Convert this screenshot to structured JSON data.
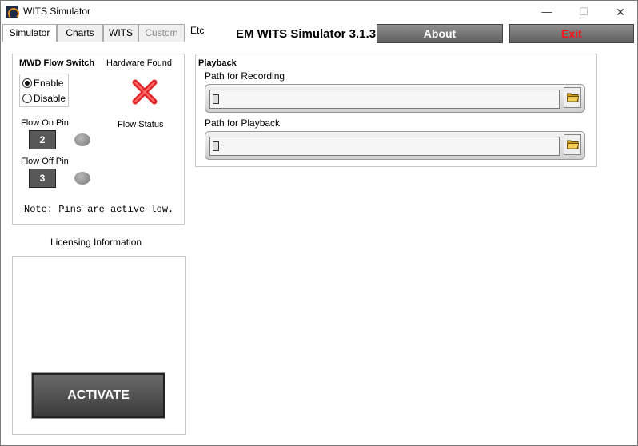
{
  "window": {
    "title": "WITS Simulator",
    "controls": {
      "minimize": "—",
      "maximize": "☐",
      "close": "✕"
    }
  },
  "tabs": [
    {
      "label": "Simulator"
    },
    {
      "label": "Charts"
    },
    {
      "label": "WITS"
    },
    {
      "label": "Custom"
    },
    {
      "label": "Etc"
    }
  ],
  "header": {
    "app_title": "EM WITS Simulator 3.1.3",
    "about_label": "About",
    "exit_label": "Exit"
  },
  "mwd": {
    "title": "MWD Flow Switch",
    "hardware_label": "Hardware Found",
    "hardware_icon": "x-mark-icon",
    "radio": {
      "enable": "Enable",
      "disable": "Disable",
      "selected": "Enable"
    },
    "flow_status_label": "Flow Status",
    "flow_on_pin_label": "Flow On Pin",
    "flow_on_pin_value": "2",
    "flow_off_pin_label": "Flow Off Pin",
    "flow_off_pin_value": "3",
    "note": "Note: Pins are active low."
  },
  "licensing": {
    "title": "Licensing Information",
    "activate_label": "ACTIVATE"
  },
  "playback": {
    "title": "Playback",
    "recording_label": "Path for Recording",
    "recording_value": "",
    "playback_label": "Path for Playback",
    "playback_value": ""
  },
  "colors": {
    "exit_text": "#ff1010",
    "x_mark": "#e0262a",
    "button_gray": "#5f5f5f"
  }
}
